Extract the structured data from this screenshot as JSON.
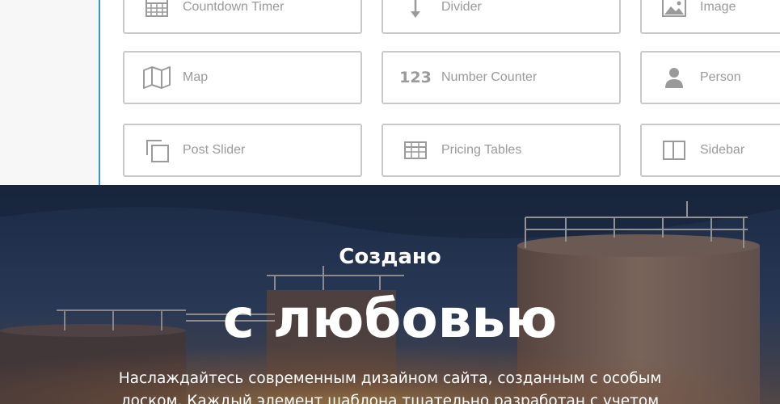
{
  "widgets": [
    {
      "label": "Countdown Timer",
      "icon": "calendar-grid-icon"
    },
    {
      "label": "Divider",
      "icon": "divider-arrow-icon"
    },
    {
      "label": "Image",
      "icon": "image-icon"
    },
    {
      "label": "Map",
      "icon": "map-icon"
    },
    {
      "label": "Number Counter",
      "icon": "number-counter-icon",
      "icon_text": "123"
    },
    {
      "label": "Person",
      "icon": "person-icon"
    },
    {
      "label": "Post Slider",
      "icon": "copy-icon"
    },
    {
      "label": "Pricing Tables",
      "icon": "table-icon"
    },
    {
      "label": "Sidebar",
      "icon": "sidebar-icon"
    }
  ],
  "hero": {
    "subtitle": "Создано",
    "title": "с любовью",
    "text": "Наслаждайтесь современным дизайном сайта, созданным с особым лоском. Каждый элемент шаблона тщательно разработан с учетом"
  },
  "colors": {
    "accent": "#2e9ad0",
    "tile_border": "#c9c9c9",
    "tile_text": "#9a9a9a"
  }
}
